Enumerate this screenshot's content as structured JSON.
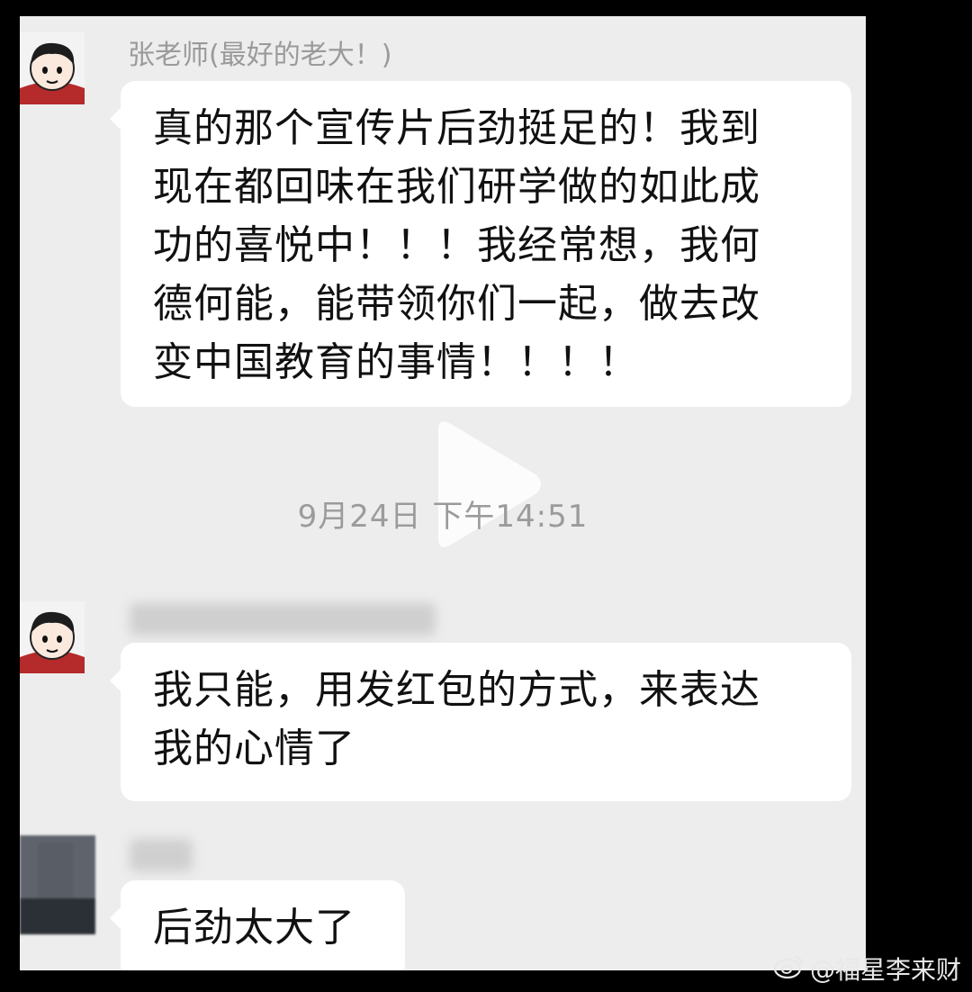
{
  "messages": [
    {
      "sender": "张老师(最好的老大！)",
      "lines": [
        "真的那个宣传片后劲挺足的！我到",
        "现在都回味在我们研学做的如此成",
        "功的喜悦中！！！我经常想，我何",
        "德何能，能带领你们一起，做去改",
        "变中国教育的事情！！！！"
      ]
    },
    {
      "lines": [
        "我只能，用发红包的方式，来表达",
        "我的心情了"
      ]
    },
    {
      "lines": [
        "后劲太大了"
      ]
    }
  ],
  "timestamp": "9月24日 下午14:51",
  "watermark": "@福星李来财",
  "icons": {
    "avatar": "cartoon-avatar",
    "play": "play-icon",
    "weibo": "weibo-logo"
  }
}
